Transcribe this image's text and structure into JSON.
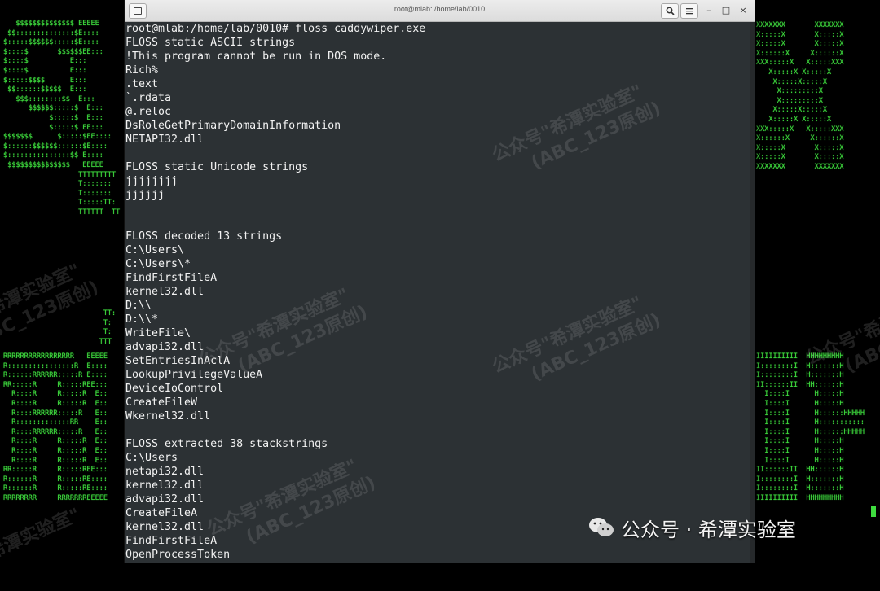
{
  "window": {
    "title": "root@mlab: /home/lab/0010",
    "buttons": {
      "new_tab_icon": "new-tab-icon",
      "search_icon": "search-icon",
      "menu_icon": "hamburger-menu-icon",
      "minimize": "–",
      "maximize": "□",
      "close": "×"
    }
  },
  "terminal": {
    "lines": [
      "root@mlab:/home/lab/0010# floss caddywiper.exe",
      "FLOSS static ASCII strings",
      "!This program cannot be run in DOS mode.",
      "Rich%",
      ".text",
      "`.rdata",
      "@.reloc",
      "DsRoleGetPrimaryDomainInformation",
      "NETAPI32.dll",
      "",
      "FLOSS static Unicode strings",
      "jjjjjjjj",
      "jjjjjj",
      "",
      "",
      "FLOSS decoded 13 strings",
      "C:\\Users\\",
      "C:\\Users\\*",
      "FindFirstFileA",
      "kernel32.dll",
      "D:\\\\",
      "D:\\\\*",
      "WriteFile\\",
      "advapi32.dll",
      "SetEntriesInAclA",
      "LookupPrivilegeValueA",
      "DeviceIoControl",
      "CreateFileW",
      "Wkernel32.dll",
      "",
      "FLOSS extracted 38 stackstrings",
      "C:\\Users",
      "netapi32.dll",
      "kernel32.dll",
      "advapi32.dll",
      "CreateFileA",
      "kernel32.dll",
      "FindFirstFileA",
      "OpenProcessToken"
    ]
  },
  "background": {
    "left_top_art": "   $$$$$$$$$$$$$$ EEEEE\n $$::::::::::::::$E::::\n$:::::$$$$$$:::::$E::::\n$::::$       $$$$$$EE:::\n$::::$          E:::\n$::::$          E:::\n$:::::$$$$      E:::\n $$::::::$$$$$  E:::\n   $$$::::::::$$  E:::\n      $$$$$$:::::$  E:::\n           $:::::$  E:::\n           $:::::$ EE:::\n$$$$$$$      $:::::$EE::::\n$::::::$$$$$$::::::$E::::\n$:::::::::::::::$$ E::::\n $$$$$$$$$$$$$$$   EEEEE\n                  TTTTTTTTT\n                  T:::::::\n                  T:::::::\n                  T:::::TT:\n                  TTTTTT  TT",
    "left_mid_art": "                        TT:\n                        T:\n                        T:\n                       TTT",
    "left_bottom_art": "RRRRRRRRRRRRRRRRR   EEEEE\nR::::::::::::::::R  E::::\nR::::::RRRRRR:::::R E::::\nRR:::::R     R:::::REE:::\n  R::::R     R:::::R  E::\n  R::::R     R:::::R  E::\n  R::::RRRRRR:::::R   E::\n  R:::::::::::::RR    E::\n  R::::RRRRRR:::::R   E::\n  R::::R     R:::::R  E::\n  R::::R     R:::::R  E::\n  R::::R     R:::::R  E::\nRR:::::R     R:::::REE:::\nR::::::R     R:::::RE::::\nR::::::R     R:::::RE::::\nRRRRRRRR     RRRRRRREEEEE",
    "right_top_art": "XXXXXXX       XXXXXXX\nX:::::X       X:::::X\nX:::::X       X:::::X\nX::::::X     X::::::X\nXXX:::::X   X:::::XXX\n   X:::::X X:::::X\n    X:::::X:::::X\n     X:::::::::X\n     X:::::::::X\n    X:::::X:::::X\n   X:::::X X:::::X\nXXX:::::X   X:::::XXX\nX::::::X     X::::::X\nX:::::X       X:::::X\nX:::::X       X:::::X\nXXXXXXX       XXXXXXX",
    "right_bottom_art": "IIIIIIIIII  HHHHHHHHH\nI::::::::I  H:::::::H\nI::::::::I  H:::::::H\nII::::::II  HH::::::H\n  I::::I      H:::::H\n  I::::I      H:::::H\n  I::::I      H::::::HHHHH\n  I::::I      H:::::::::::\n  I::::I      H::::::HHHHH\n  I::::I      H:::::H\n  I::::I      H:::::H\n  I::::I      H:::::H\nII::::::II  HH::::::H\nI::::::::I  H:::::::H\nI::::::::I  H:::::::H\nIIIIIIIIII  HHHHHHHHH"
  },
  "watermark": {
    "line1": "公众号\"希潭实验室\"",
    "line2": "(ABC_123原创)"
  },
  "brand": {
    "icon": "wechat-icon",
    "text": "公众号 · 希潭实验室"
  }
}
